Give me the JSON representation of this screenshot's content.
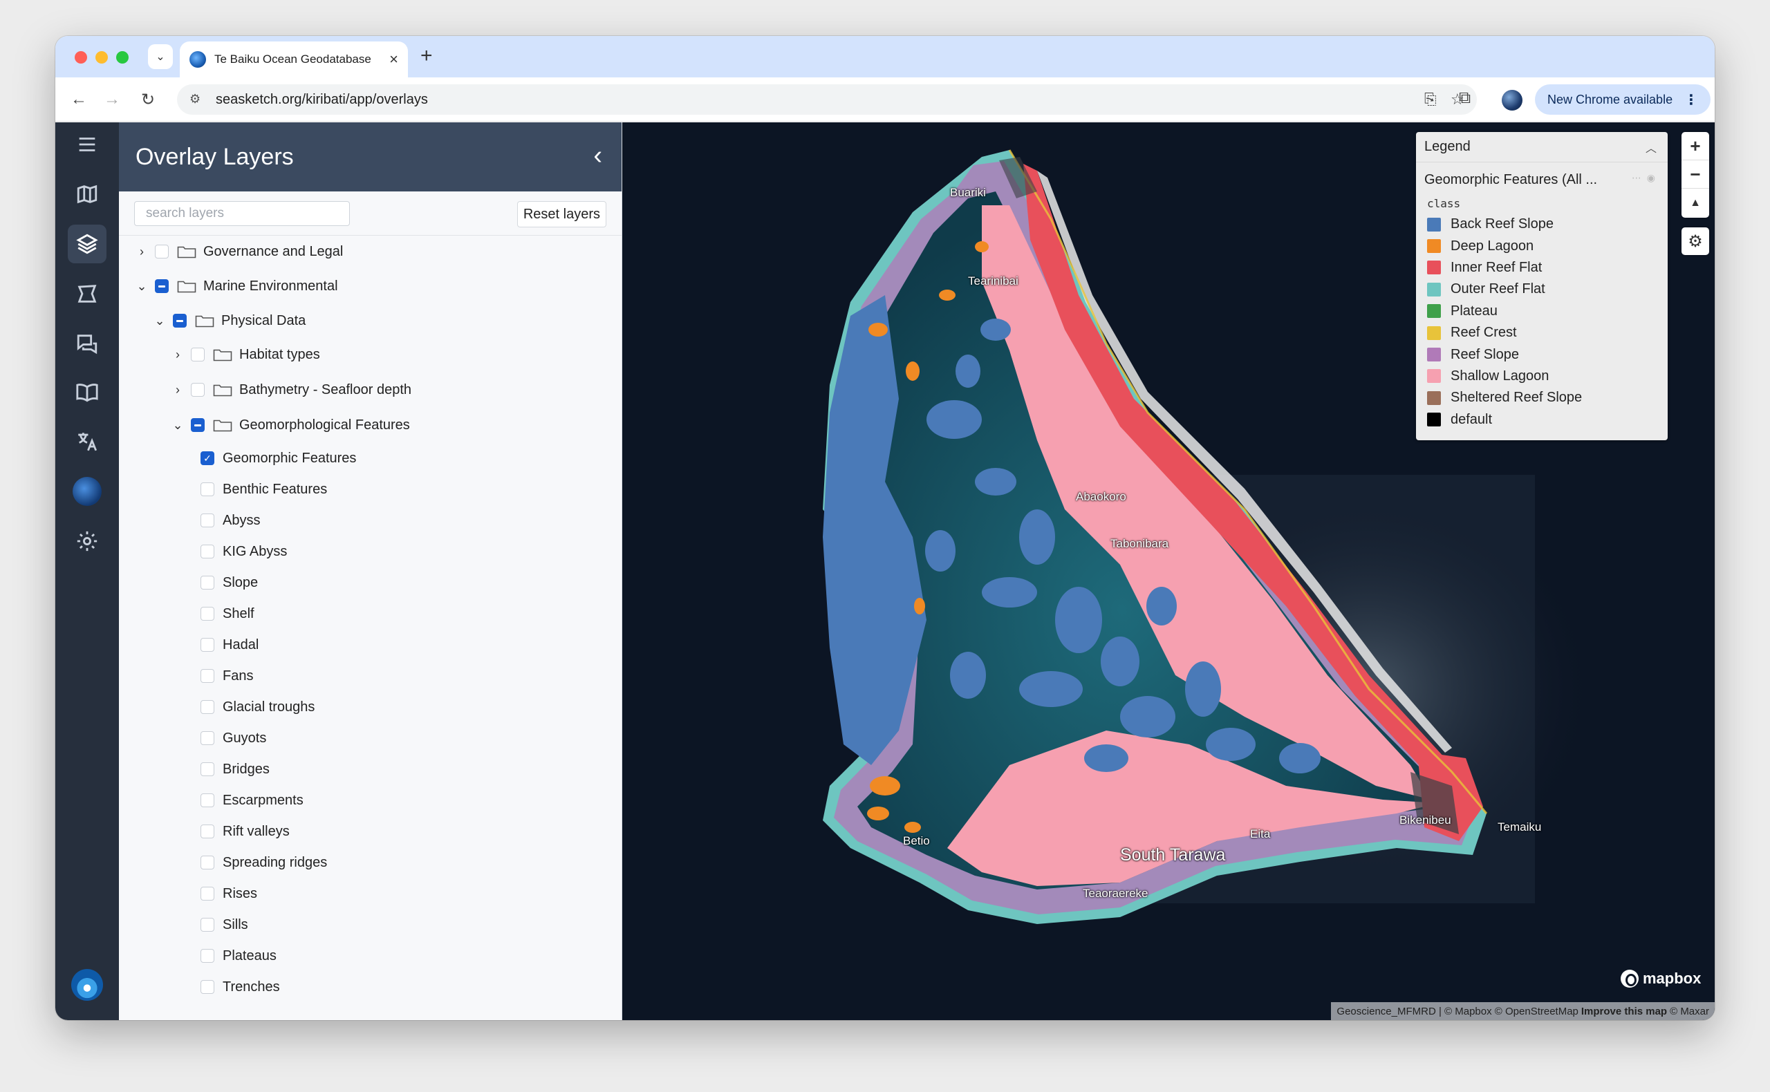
{
  "browser": {
    "tab_title": "Te Baiku Ocean Geodatabase",
    "url": "seasketch.org/kiribati/app/overlays",
    "update_label": "New Chrome available"
  },
  "panel": {
    "title": "Overlay Layers",
    "search_placeholder": "search layers",
    "reset_label": "Reset layers"
  },
  "tree": [
    {
      "label": "Governance and Legal",
      "state": "unchecked",
      "expand": "collapsed",
      "folder": true
    },
    {
      "label": "Marine Environmental",
      "state": "partial",
      "expand": "expanded",
      "folder": true
    },
    {
      "label": "Physical Data",
      "state": "partial",
      "expand": "expanded",
      "folder": true
    },
    {
      "label": "Habitat types",
      "state": "unchecked",
      "expand": "collapsed",
      "folder": true
    },
    {
      "label": "Bathymetry - Seafloor depth",
      "state": "unchecked",
      "expand": "collapsed",
      "folder": true
    },
    {
      "label": "Geomorphological Features",
      "state": "partial",
      "expand": "expanded",
      "folder": true
    },
    {
      "label": "Geomorphic Features",
      "state": "checked"
    },
    {
      "label": "Benthic Features",
      "state": "unchecked"
    },
    {
      "label": "Abyss",
      "state": "unchecked"
    },
    {
      "label": "KIG Abyss",
      "state": "unchecked"
    },
    {
      "label": "Slope",
      "state": "unchecked"
    },
    {
      "label": "Shelf",
      "state": "unchecked"
    },
    {
      "label": "Hadal",
      "state": "unchecked"
    },
    {
      "label": "Fans",
      "state": "unchecked"
    },
    {
      "label": "Glacial troughs",
      "state": "unchecked"
    },
    {
      "label": "Guyots",
      "state": "unchecked"
    },
    {
      "label": "Bridges",
      "state": "unchecked"
    },
    {
      "label": "Escarpments",
      "state": "unchecked"
    },
    {
      "label": "Rift valleys",
      "state": "unchecked"
    },
    {
      "label": "Spreading ridges",
      "state": "unchecked"
    },
    {
      "label": "Rises",
      "state": "unchecked"
    },
    {
      "label": "Sills",
      "state": "unchecked"
    },
    {
      "label": "Plateaus",
      "state": "unchecked"
    },
    {
      "label": "Trenches",
      "state": "unchecked"
    }
  ],
  "legend": {
    "title": "Legend",
    "layer_name": "Geomorphic Features (All ...",
    "attribute": "class",
    "items": [
      {
        "label": "Back Reef Slope",
        "color": "#4a7ab8"
      },
      {
        "label": "Deep Lagoon",
        "color": "#f08a24"
      },
      {
        "label": "Inner Reef Flat",
        "color": "#e8505b"
      },
      {
        "label": "Outer Reef Flat",
        "color": "#6ec5c0"
      },
      {
        "label": "Plateau",
        "color": "#3fa04a"
      },
      {
        "label": "Reef Crest",
        "color": "#e8c33a"
      },
      {
        "label": "Reef Slope",
        "color": "#b07ab8"
      },
      {
        "label": "Shallow Lagoon",
        "color": "#f6a0b0"
      },
      {
        "label": "Sheltered Reef Slope",
        "color": "#9a6f5a"
      },
      {
        "label": "default",
        "color": "#000000"
      }
    ]
  },
  "map": {
    "places": [
      "Buariki",
      "Tearinibai",
      "Abaokoro",
      "Tabonibara",
      "Betio",
      "Eita",
      "South Tarawa",
      "Bikenibeu",
      "Temaiku",
      "Teaoraereke"
    ],
    "mapbox_label": "mapbox",
    "attribution": {
      "prefix": "Geoscience_MFMRD | © Mapbox © OpenStreetMap",
      "improve": "Improve this map",
      "suffix": "© Maxar"
    }
  }
}
